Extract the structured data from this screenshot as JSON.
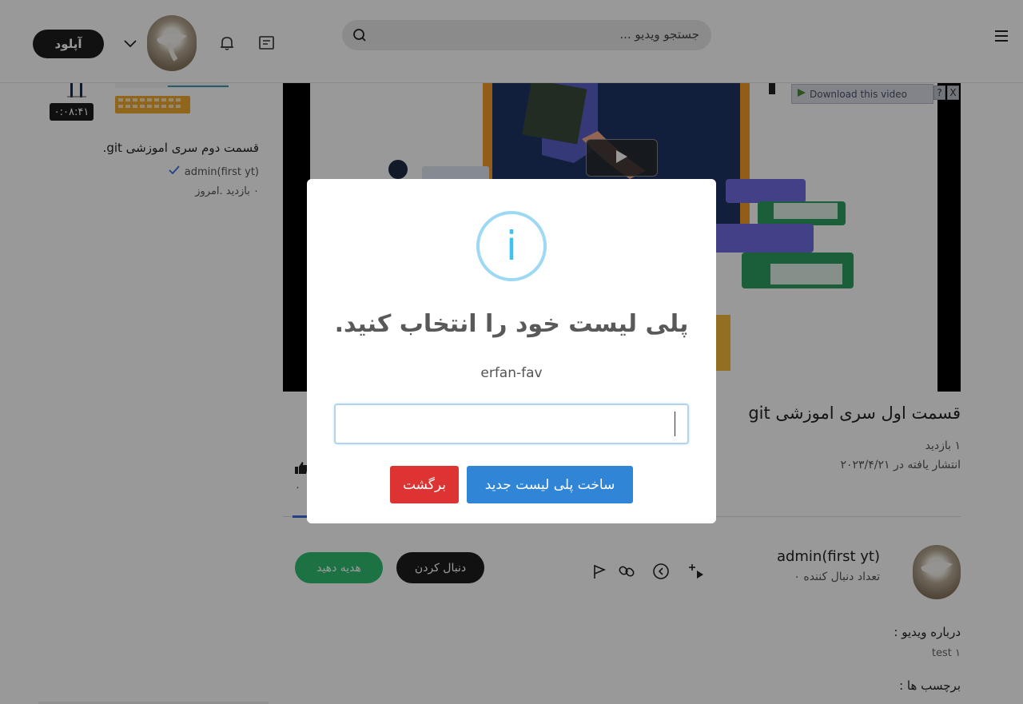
{
  "header": {
    "upload_label": "آپلود",
    "search_placeholder": "جستجو ویدیو ..."
  },
  "sidebar": {
    "video": {
      "duration": "۰:۰۸:۴۱",
      "title": "قسمت دوم سری اموزشی git.",
      "author": "admin(first yt)",
      "meta": "۰ بازدید .امروز"
    }
  },
  "player": {
    "download_label": "Download this video",
    "help_glyph": "?",
    "close_glyph": "X"
  },
  "video": {
    "title": "قسمت اول سری اموزشی git",
    "views": "۱ بازدید",
    "published": "انتشار یافته در ۲۰۲۳/۴/۲۱",
    "likes": "۰"
  },
  "channel": {
    "name": "admin(first yt)",
    "subscribers": "تعداد دنبال کننده ۰",
    "follow_label": "دنبال کردن",
    "gift_label": "هدیه دهید"
  },
  "about": {
    "label": "درباره ویدیو :",
    "description": "test ۱",
    "tags_label": "برچسب ها :"
  },
  "modal": {
    "icon_glyph": "i",
    "title": "پلی لیست خود را انتخاب کنید.",
    "text": "erfan-fav",
    "input_value": "",
    "create_label": "ساخت پلی لیست جدید",
    "back_label": "برگشت"
  },
  "colors": {
    "accent_blue": "#3085d6",
    "danger_red": "#dd3333",
    "gift_green": "#2fbf71",
    "info_blue": "#3fc3ee"
  },
  "icons": [
    "menu-icon",
    "search-icon",
    "message-icon",
    "bell-icon",
    "chevron-down-icon",
    "play-icon",
    "like-icon",
    "add-to-playlist-icon",
    "watch-later-icon",
    "link-icon",
    "flag-icon",
    "verified-icon",
    "info-icon"
  ]
}
